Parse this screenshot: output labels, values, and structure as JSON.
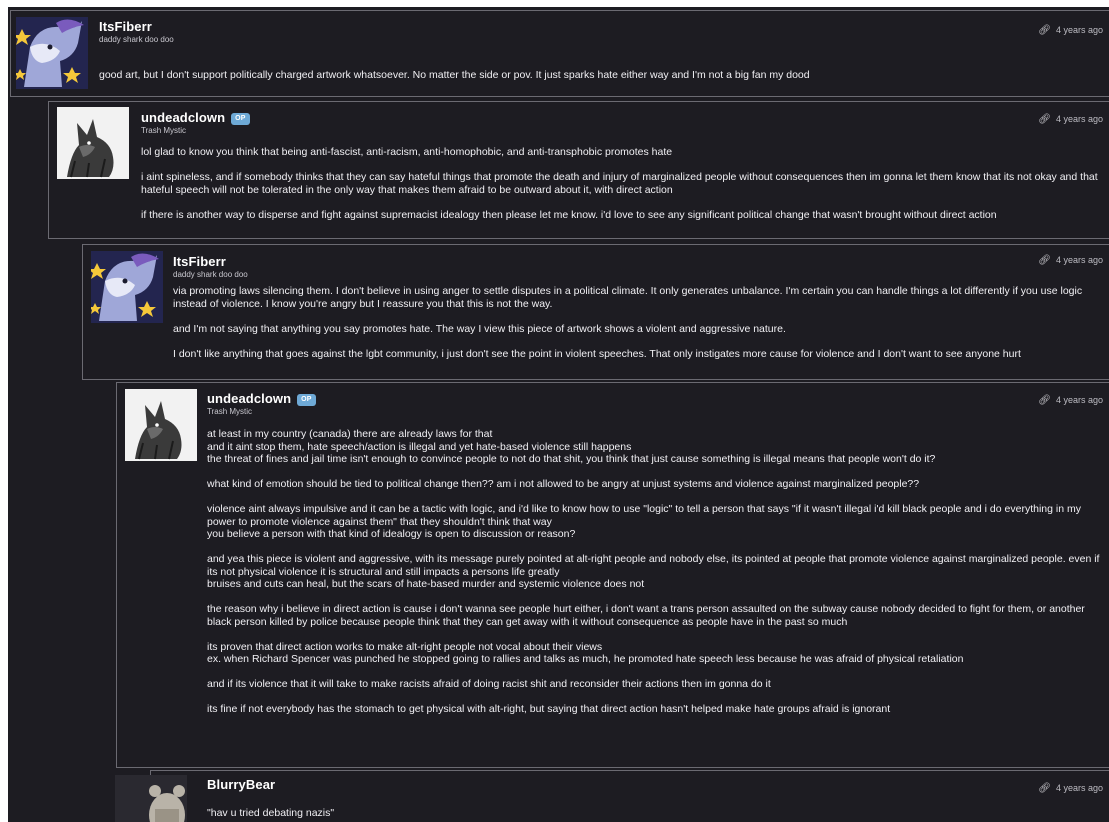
{
  "comments": [
    {
      "username": "ItsFiberr",
      "user_title": "daddy shark doo doo",
      "op": false,
      "time": "4 years ago",
      "avatar": "dragon-avatar",
      "paragraphs": [
        "good art, but I don't support politically charged artwork whatsoever. No matter the side or pov. It just sparks hate either way and I'm not a big fan my dood"
      ]
    },
    {
      "username": "undeadclown",
      "user_title": "Trash Mystic",
      "op": true,
      "op_label": "OP",
      "time": "4 years ago",
      "avatar": "wolf-sketch-avatar",
      "paragraphs": [
        "lol glad to know you think that being anti-fascist, anti-racism, anti-homophobic, and anti-transphobic promotes hate",
        "",
        "i aint spineless, and if somebody thinks that they can say hateful things that promote the death and injury of marginalized people without consequences then im gonna let them know that its not okay and that hateful speech will not be tolerated in the only way that makes them afraid to be outward about it, with direct action",
        "",
        "if there is another way to disperse and fight against supremacist idealogy then please let me know. i'd love to see any significant political change that wasn't brought without direct action"
      ]
    },
    {
      "username": "ItsFiberr",
      "user_title": "daddy shark doo doo",
      "op": false,
      "time": "4 years ago",
      "avatar": "dragon-avatar",
      "paragraphs": [
        "via promoting laws silencing them. I don't believe in using anger to settle disputes in a political climate. It only generates unbalance. I'm certain you can handle things a lot differently if you use logic instead of violence. I know you're angry but I reassure you that this is not the way.",
        "",
        "and I'm not saying that anything you say promotes hate. The way I view this piece of artwork shows a violent and aggressive nature.",
        "",
        "I don't like anything that goes against the lgbt community, i just don't see the point in violent speeches. That only instigates more cause for violence and I don't want to see anyone hurt"
      ]
    },
    {
      "username": "undeadclown",
      "user_title": "Trash Mystic",
      "op": true,
      "op_label": "OP",
      "time": "4 years ago",
      "avatar": "wolf-sketch-avatar",
      "paragraphs": [
        "at least in my country (canada) there are already laws for that",
        "and it aint stop them, hate speech/action is illegal and yet hate-based violence still happens",
        "the threat of fines and jail time isn't enough to convince people to not do that shit, you think that just cause something is illegal means that people won't do it?",
        "",
        "what kind of emotion should be tied to political change then?? am i not allowed to be angry at unjust systems and violence against marginalized people??",
        "",
        "violence aint always impulsive and it can be a tactic with logic, and i'd like to know how to use \"logic\" to tell a person that says \"if it wasn't illegal i'd kill black people and i do everything in my power to promote violence against them\" that they shouldn't think that way",
        "you believe a person with that kind of idealogy is open to discussion or reason?",
        "",
        "and yea this piece is violent and aggressive, with its message purely pointed at alt-right people and nobody else, its pointed at people that promote violence against marginalized people. even if its not physical violence it is structural and still impacts a persons life greatly",
        "bruises and cuts can heal, but the scars of hate-based murder and systemic violence does not",
        "",
        "the reason why i believe in direct action is cause i don't wanna see people hurt either, i don't want a trans person assaulted on the subway cause nobody decided to fight for them, or another black person killed by police because people think that they can get away with it without consequence as people have in the past so much",
        "",
        "its proven that direct action works to make alt-right people not vocal about their views",
        "ex. when Richard Spencer was punched he stopped going to rallies and talks as much, he promoted hate speech less because he was afraid of physical retaliation",
        "",
        "and if its violence that it will take to make racists afraid of doing racist shit and reconsider their actions then im gonna do it",
        "",
        "its fine if not everybody has the stomach to get physical with alt-right, but saying that direct action hasn't helped make hate groups afraid is ignorant"
      ]
    },
    {
      "username": "BlurryBear",
      "user_title": "",
      "op": false,
      "time": "4 years ago",
      "avatar": "bear-avatar",
      "paragraphs": [
        "\"hav u tried debating nazis\""
      ]
    }
  ],
  "colors": {
    "background": "#1d1c22",
    "border": "#6b6a72",
    "text": "#f1f0f4",
    "op_badge": "#6ea9d6"
  },
  "icons": {
    "timestamp_link": "link-icon"
  }
}
